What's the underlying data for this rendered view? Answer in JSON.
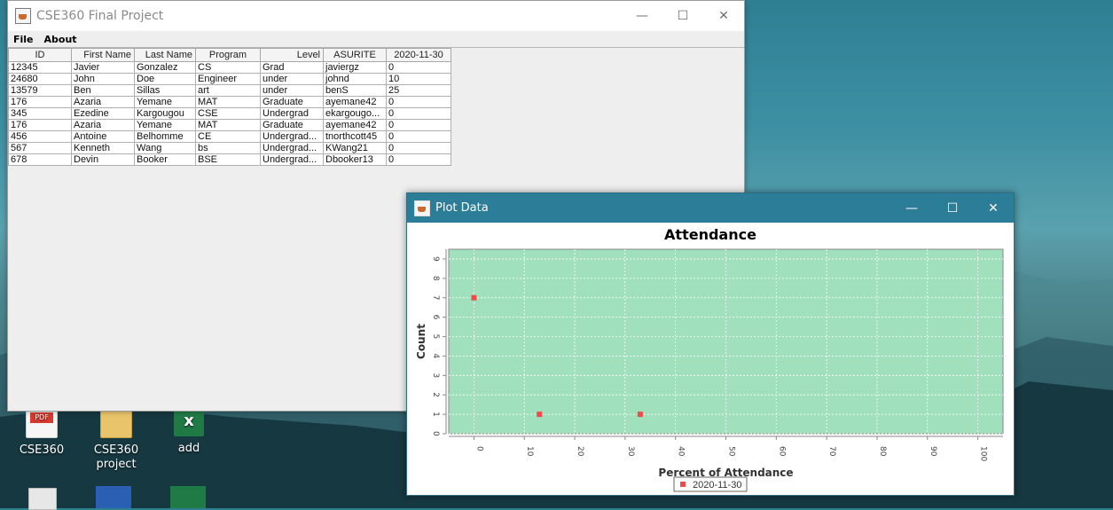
{
  "main_window": {
    "title": "CSE360 Final Project",
    "menu": [
      "File",
      "About"
    ],
    "columns": [
      "ID",
      "First Name",
      "Last Name",
      "Program",
      "Level",
      "ASURITE",
      "2020-11-30"
    ],
    "rows": [
      [
        "12345",
        "Javier",
        "Gonzalez",
        "CS",
        "Grad",
        "javiergz",
        "0"
      ],
      [
        "24680",
        "John",
        "Doe",
        "Engineer",
        "under",
        "johnd",
        "10"
      ],
      [
        "13579",
        "Ben",
        "Sillas",
        "art",
        "under",
        "benS",
        "25"
      ],
      [
        "176",
        "Azaria",
        "Yemane",
        "MAT",
        "Graduate",
        "ayemane42",
        "0"
      ],
      [
        "345",
        "Ezedine",
        "Kargougou",
        "CSE",
        "Undergrad",
        "ekargougo...",
        "0"
      ],
      [
        "176",
        "Azaria",
        "Yemane",
        "MAT",
        "Graduate",
        "ayemane42",
        "0"
      ],
      [
        "456",
        "Antoine",
        "Belhomme",
        "CE",
        "Undergrad...",
        "tnorthcott45",
        "0"
      ],
      [
        "567",
        "Kenneth",
        "Wang",
        "bs",
        "Undergrad...",
        "KWang21",
        "0"
      ],
      [
        "678",
        "Devin",
        "Booker",
        "BSE",
        "Undergrad...",
        "Dbooker13",
        "0"
      ]
    ]
  },
  "plot_window": {
    "title": "Plot Data"
  },
  "chart_data": {
    "type": "scatter",
    "title": "Attendance",
    "xlabel": "Percent of Attendance",
    "ylabel": "Count",
    "xlim": [
      -5,
      105
    ],
    "ylim": [
      0,
      9.5
    ],
    "xticks": [
      0,
      10,
      20,
      30,
      40,
      50,
      60,
      70,
      80,
      90,
      100
    ],
    "yticks": [
      0,
      1,
      2,
      3,
      4,
      5,
      6,
      7,
      8,
      9
    ],
    "grid": true,
    "legend_position": "bottom",
    "series": [
      {
        "name": "2020-11-30",
        "color": "#f04b4b",
        "x": [
          0,
          13,
          33
        ],
        "y": [
          7,
          1,
          1
        ]
      }
    ],
    "plot_background": "#a1e0bc"
  },
  "desktop": {
    "icons": [
      {
        "label": "CSE360",
        "icon": "pdf-icon"
      },
      {
        "label": "CSE360 project",
        "icon": "folder-icon"
      },
      {
        "label": "add",
        "icon": "excel-icon"
      }
    ]
  }
}
